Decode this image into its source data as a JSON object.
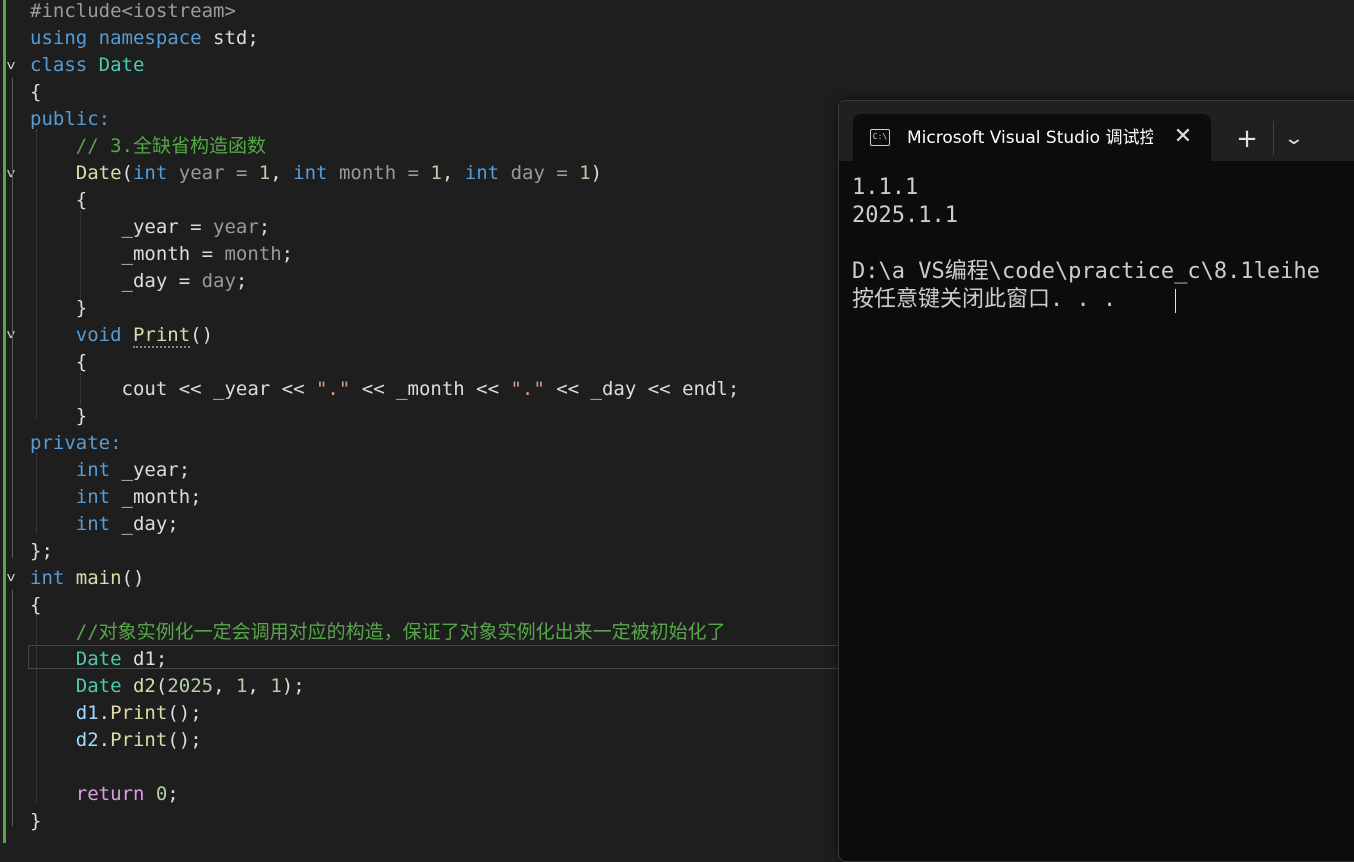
{
  "editor": {
    "lines": [
      [
        [
          "#include<iostream>",
          "pp"
        ]
      ],
      [
        [
          "using ",
          "kw"
        ],
        [
          "namespace ",
          "kw"
        ],
        [
          "std;",
          ""
        ]
      ],
      [
        [
          "class ",
          "kw"
        ],
        [
          "Date",
          "type"
        ]
      ],
      [
        [
          "{",
          ""
        ]
      ],
      [
        [
          "public:",
          "kw"
        ]
      ],
      [
        [
          "    ",
          ""
        ],
        [
          "// 3.全缺省构造函数",
          "cm"
        ]
      ],
      [
        [
          "    ",
          ""
        ],
        [
          "Date",
          "fn"
        ],
        [
          "(",
          ""
        ],
        [
          "int ",
          "kw"
        ],
        [
          "year = ",
          "par"
        ],
        [
          "1",
          "num"
        ],
        [
          ", ",
          ""
        ],
        [
          "int ",
          "kw"
        ],
        [
          "month = ",
          "par"
        ],
        [
          "1",
          "num"
        ],
        [
          ", ",
          ""
        ],
        [
          "int ",
          "kw"
        ],
        [
          "day = ",
          "par"
        ],
        [
          "1",
          "num"
        ],
        [
          ")",
          ""
        ]
      ],
      [
        [
          "    {",
          ""
        ]
      ],
      [
        [
          "        _year = ",
          ""
        ],
        [
          "year",
          "par"
        ],
        [
          ";",
          ""
        ]
      ],
      [
        [
          "        _month = ",
          ""
        ],
        [
          "month",
          "par"
        ],
        [
          ";",
          ""
        ]
      ],
      [
        [
          "        _day = ",
          ""
        ],
        [
          "day",
          "par"
        ],
        [
          ";",
          ""
        ]
      ],
      [
        [
          "    }",
          ""
        ]
      ],
      [
        [
          "    ",
          ""
        ],
        [
          "void ",
          "kw"
        ],
        [
          "Print",
          "fn"
        ],
        [
          "()",
          ""
        ]
      ],
      [
        [
          "    {",
          ""
        ]
      ],
      [
        [
          "        cout << _year << ",
          ""
        ],
        [
          "\".\"",
          "str"
        ],
        [
          " << _month << ",
          ""
        ],
        [
          "\".\"",
          "str"
        ],
        [
          " << _day << endl;",
          ""
        ]
      ],
      [
        [
          "    }",
          ""
        ]
      ],
      [
        [
          "private:",
          "kw"
        ]
      ],
      [
        [
          "    ",
          ""
        ],
        [
          "int ",
          "kw"
        ],
        [
          "_year;",
          ""
        ]
      ],
      [
        [
          "    ",
          ""
        ],
        [
          "int ",
          "kw"
        ],
        [
          "_month;",
          ""
        ]
      ],
      [
        [
          "    ",
          ""
        ],
        [
          "int ",
          "kw"
        ],
        [
          "_day;",
          ""
        ]
      ],
      [
        [
          "};",
          ""
        ]
      ],
      [
        [
          "int ",
          "kw"
        ],
        [
          "main",
          "fn"
        ],
        [
          "()",
          ""
        ]
      ],
      [
        [
          "{",
          ""
        ]
      ],
      [
        [
          "    ",
          ""
        ],
        [
          "//对象实例化一定会调用对应的构造，保证了对象实例化出来一定被初始化了",
          "cm"
        ]
      ],
      [
        [
          "    ",
          ""
        ],
        [
          "Date ",
          "type"
        ],
        [
          "d1;",
          ""
        ]
      ],
      [
        [
          "    ",
          ""
        ],
        [
          "Date ",
          "type"
        ],
        [
          "d2",
          "fn"
        ],
        [
          "(",
          ""
        ],
        [
          "2025",
          "num"
        ],
        [
          ", ",
          ""
        ],
        [
          "1",
          "num"
        ],
        [
          ", ",
          ""
        ],
        [
          "1",
          "num"
        ],
        [
          ");",
          ""
        ]
      ],
      [
        [
          "    ",
          ""
        ],
        [
          "d1",
          "var"
        ],
        [
          ".",
          ""
        ],
        [
          "Print",
          "fn"
        ],
        [
          "();",
          ""
        ]
      ],
      [
        [
          "    ",
          ""
        ],
        [
          "d2",
          "var"
        ],
        [
          ".",
          ""
        ],
        [
          "Print",
          "fn"
        ],
        [
          "();",
          ""
        ]
      ],
      [
        [
          "",
          ""
        ]
      ],
      [
        [
          "    ",
          ""
        ],
        [
          "return ",
          "ctl"
        ],
        [
          "0",
          "num"
        ],
        [
          ";",
          ""
        ]
      ],
      [
        [
          "}",
          ""
        ]
      ]
    ]
  },
  "terminal": {
    "tab_title": "Microsoft Visual Studio 调试控制台",
    "icon_text": "C:\\",
    "close_glyph": "✕",
    "new_tab_glyph": "+",
    "dropdown_glyph": "⌄",
    "output": [
      "1.1.1",
      "2025.1.1",
      "",
      "D:\\a VS编程\\code\\practice_c\\8.1leihe",
      "按任意键关闭此窗口. . ."
    ]
  },
  "colors": {
    "editor_bg": "#1e1e1e",
    "terminal_bg": "#0c0c0c",
    "keyword": "#569cd6",
    "control": "#d8a0df",
    "type": "#4ec9b0",
    "function": "#dcdcaa",
    "comment": "#57a64a",
    "string": "#d69d85",
    "number": "#b5cea8",
    "parameter": "#9a9a9a",
    "variable": "#9cdcfe"
  }
}
